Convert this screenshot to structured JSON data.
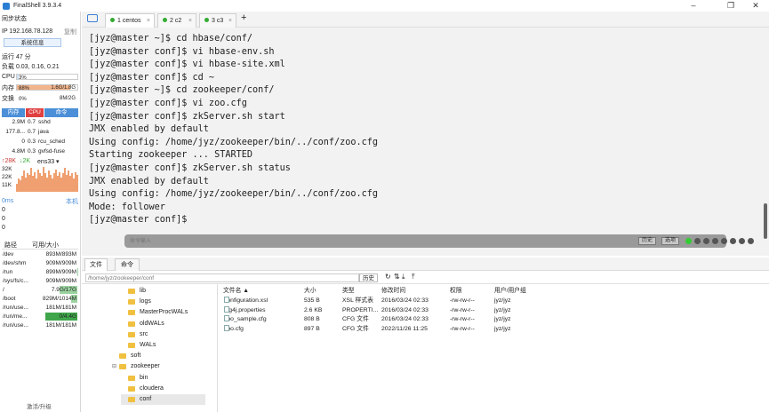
{
  "window": {
    "title": "FinalShell 3.9.3.4"
  },
  "left": {
    "sync_status": "同步状态",
    "ip": "IP 192.168.78.128",
    "copy": "复制",
    "sysinfo_button": "系统信息",
    "uptime": "运行 47 分",
    "load": "负载 0.03, 0.16, 0.21",
    "cpu_label": "CPU",
    "cpu_value": "3%",
    "cpu_fraction": 0.03,
    "mem_label": "内存",
    "mem_percent": "88%",
    "mem_value": "1.6G/1.8G",
    "mem_fraction": 0.88,
    "swap_label": "交换",
    "swap_percent": "0%",
    "swap_value": "8M/2G",
    "proc_tabs": [
      "内存",
      "CPU",
      "命令"
    ],
    "processes": [
      {
        "mem": "2.9M",
        "cpu": "0.7",
        "cmd": "sshd"
      },
      {
        "mem": "177.8...",
        "cpu": "0.7",
        "cmd": "java"
      },
      {
        "mem": "0",
        "cpu": "0.3",
        "cmd": "rcu_sched"
      },
      {
        "mem": "4.8M",
        "cpu": "0.3",
        "cmd": "gvfsd-fuse"
      }
    ],
    "net_up": "↑28K",
    "net_down": "↓2K",
    "net_if": "ens33 ▾",
    "net_ticks": [
      "32K",
      "22K",
      "11K"
    ],
    "net_bars": [
      0.3,
      0.5,
      0.45,
      0.6,
      0.8,
      0.55,
      0.7,
      0.65,
      0.9,
      0.6,
      0.75,
      0.5,
      0.85,
      0.7,
      0.6,
      0.95,
      0.7,
      0.55,
      0.8,
      0.65,
      0.5,
      0.7,
      0.85,
      0.6,
      0.75,
      0.55,
      0.7,
      0.9,
      0.65,
      0.8,
      0.6,
      0.7,
      0.5,
      0.75,
      0.65
    ],
    "ping_ms": "0ms",
    "ping_host": "本机",
    "ping_values": [
      "0",
      "0",
      "0"
    ],
    "disk_headers": [
      "路径",
      "可用/大小"
    ],
    "disks": [
      {
        "path": "/dev",
        "size": "893M/893M",
        "used": 0.0
      },
      {
        "path": "/dev/shm",
        "size": "909M/909M",
        "used": 0.0
      },
      {
        "path": "/run",
        "size": "899M/909M",
        "used": 0.01
      },
      {
        "path": "/sys/fs/c...",
        "size": "909M/909M",
        "used": 0.0
      },
      {
        "path": "/",
        "size": "7.9G/17G",
        "used": 0.54
      },
      {
        "path": "/boot",
        "size": "829M/1014M",
        "used": 0.18
      },
      {
        "path": "/run/use...",
        "size": "181M/181M",
        "used": 0.0
      },
      {
        "path": "/run/me...",
        "size": "0/4.4G",
        "used": 1.0
      },
      {
        "path": "/run/use...",
        "size": "181M/181M",
        "used": 0.0
      }
    ],
    "upgrade": "激活/升级"
  },
  "tabs": [
    {
      "label": "1 centos"
    },
    {
      "label": "2 c2"
    },
    {
      "label": "3 c3"
    }
  ],
  "add_tab": "+",
  "terminal": {
    "lines": [
      "[jyz@master ~]$ cd hbase/conf/",
      "[jyz@master conf]$ vi hbase-env.sh",
      "[jyz@master conf]$ vi hbase-site.xml",
      "[jyz@master conf]$ cd ~",
      "[jyz@master ~]$ cd zookeeper/conf/",
      "[jyz@master conf]$ vi zoo.cfg",
      "[jyz@master conf]$ zkServer.sh start",
      "JMX enabled by default",
      "Using config: /home/jyz/zookeeper/bin/../conf/zoo.cfg",
      "Starting zookeeper ... STARTED",
      "[jyz@master conf]$ zkServer.sh status",
      "JMX enabled by default",
      "Using config: /home/jyz/zookeeper/bin/../conf/zoo.cfg",
      "Mode: follower",
      "[jyz@master conf]$"
    ],
    "command_placeholder": "命令输入",
    "history_button": "历史",
    "options_button": "选项"
  },
  "bottom_tabs": [
    "文件",
    "命令"
  ],
  "path": {
    "value": "/home/jyz/zookeeper/conf",
    "history": "历史"
  },
  "tree": [
    {
      "label": "lib",
      "indent": 3,
      "toggle": ""
    },
    {
      "label": "logs",
      "indent": 3,
      "toggle": ""
    },
    {
      "label": "MasterProcWALs",
      "indent": 3,
      "toggle": ""
    },
    {
      "label": "oldWALs",
      "indent": 3,
      "toggle": ""
    },
    {
      "label": "src",
      "indent": 3,
      "toggle": ""
    },
    {
      "label": "WALs",
      "indent": 3,
      "toggle": ""
    },
    {
      "label": "soft",
      "indent": 2,
      "toggle": ""
    },
    {
      "label": "zookeeper",
      "indent": 2,
      "toggle": "⊟"
    },
    {
      "label": "bin",
      "indent": 3,
      "toggle": ""
    },
    {
      "label": "cloudera",
      "indent": 3,
      "toggle": ""
    },
    {
      "label": "conf",
      "indent": 3,
      "toggle": ""
    }
  ],
  "file_headers": [
    "文件名 ▲",
    "大小",
    "类型",
    "修改时间",
    "权限",
    "用户/用户组"
  ],
  "files": [
    {
      "name": "configuration.xsl",
      "size": "535 B",
      "type": "XSL 样式表",
      "mtime": "2016/03/24 02:33",
      "perm": "-rw-rw-r--",
      "owner": "jyz/jyz"
    },
    {
      "name": "log4j.properties",
      "size": "2.6 KB",
      "type": "PROPERTI...",
      "mtime": "2016/03/24 02:33",
      "perm": "-rw-rw-r--",
      "owner": "jyz/jyz"
    },
    {
      "name": "zoo_sample.cfg",
      "size": "808 B",
      "type": "CFG 文件",
      "mtime": "2016/03/24 02:33",
      "perm": "-rw-rw-r--",
      "owner": "jyz/jyz"
    },
    {
      "name": "zoo.cfg",
      "size": "897 B",
      "type": "CFG 文件",
      "mtime": "2022/11/26 11:25",
      "perm": "-rw-rw-r--",
      "owner": "jyz/jyz"
    }
  ],
  "colors": {
    "accent": "#3d7fd6",
    "proc_tab_cpu": "#e04040",
    "mem_fill": "#f2b48a",
    "disk_fill": "#9bd3a0",
    "disk_full": "#3fa54a"
  }
}
